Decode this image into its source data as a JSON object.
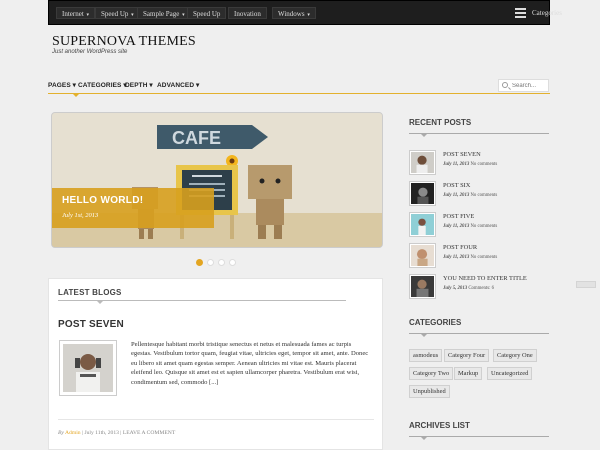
{
  "topbar": {
    "menu": [
      {
        "label": "Internet",
        "caret": "▾"
      },
      {
        "label": "Speed Up",
        "caret": "▾"
      },
      {
        "label": "Sample Page",
        "caret": "▾"
      },
      {
        "label": "Speed Up",
        "caret": ""
      },
      {
        "label": "Inovation",
        "caret": ""
      },
      {
        "label": "Windows",
        "caret": "▾"
      }
    ],
    "categories_label": "Categories"
  },
  "header": {
    "site_title": "SUPERNOVA THEMES",
    "site_description": "Just another WordPress site"
  },
  "nav": {
    "items": [
      {
        "label": "PAGES ▾"
      },
      {
        "label": "CATEGORIES ▾"
      },
      {
        "label": "DEPTH ▾"
      },
      {
        "label": "ADVANCED ▾"
      }
    ],
    "search_placeholder": "Search..."
  },
  "slider": {
    "caption_title": "HELLO WORLD!",
    "caption_date": "July 1st, 2013",
    "sign_text": "CAFE",
    "active_slide": 1,
    "slide_count": 4
  },
  "latest": {
    "title": "LATEST BLOGS",
    "post": {
      "title": "POST SEVEN",
      "excerpt": "Pellentesque habitant morbi tristique senectus et netus et malesuada fames ac turpis egestas. Vestibulum tortor quam, feugiat vitae, ultricies eget, tempor sit amet, ante. Donec eu libero sit amet quam egestas semper. Aenean ultricies mi vitae est. Mauris placerat eleifend leo. Quisque sit amet est et sapien ullamcorper pharetra. Vestibulum erat wisi, condimentum sed, commodo [...]",
      "meta_by": "By",
      "meta_author": "Admin",
      "meta_rest": " | July 11th, 2013 | LEAVE A COMMENT"
    }
  },
  "sidebar": {
    "recent_title": "RECENT POSTS",
    "recent": [
      {
        "title": "POST SEVEN",
        "date": "July 11, 2013",
        "comments": "No comments"
      },
      {
        "title": "POST SIX",
        "date": "July 11, 2013",
        "comments": "No comments"
      },
      {
        "title": "POST FIVE",
        "date": "July 11, 2013",
        "comments": "No comments"
      },
      {
        "title": "POST FOUR",
        "date": "July 11, 2013",
        "comments": "No comments"
      },
      {
        "title": "YOU NEED TO ENTER TITLE",
        "date": "July 5, 2013",
        "comments": "Comments: 6"
      }
    ],
    "categories_title": "CATEGORIES",
    "categories": [
      "asmodeus",
      "Category Four",
      "Category One",
      "Category Two",
      "Markup",
      "Uncategorized",
      "Unpublished"
    ],
    "archives_title": "ARCHIVES LIST"
  },
  "colors": {
    "accent": "#e3a521",
    "topbar": "#1e1e1e",
    "background": "#efefef"
  }
}
